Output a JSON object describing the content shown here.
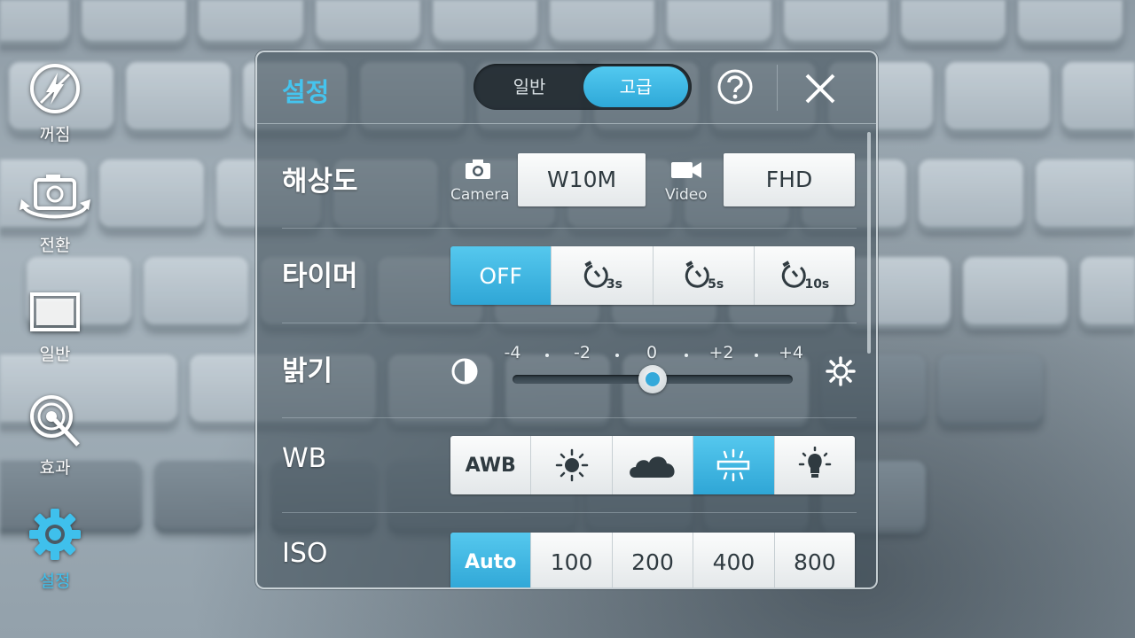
{
  "rail": {
    "flash": {
      "label": "꺼짐",
      "icon": "flash-off-icon"
    },
    "switch": {
      "label": "전환",
      "icon": "switch-camera-icon"
    },
    "mode": {
      "label": "일반",
      "icon": "normal-mode-icon"
    },
    "effects": {
      "label": "효과",
      "icon": "effects-icon"
    },
    "settings": {
      "label": "설정",
      "icon": "gear-icon"
    }
  },
  "panel": {
    "title": "설정",
    "tabs": [
      {
        "label": "일반",
        "selected": false
      },
      {
        "label": "고급",
        "selected": true
      }
    ],
    "help_icon": "help-icon",
    "close_icon": "close-icon"
  },
  "resolution": {
    "label": "해상도",
    "camera_caption": "Camera",
    "camera_value": "W10M",
    "video_caption": "Video",
    "video_value": "FHD"
  },
  "timer": {
    "label": "타이머",
    "options": [
      {
        "label": "OFF",
        "selected": true
      },
      {
        "label": "3s",
        "icon": "timer-icon",
        "selected": false
      },
      {
        "label": "5s",
        "icon": "timer-icon",
        "selected": false
      },
      {
        "label": "10s",
        "icon": "timer-icon",
        "selected": false
      }
    ]
  },
  "brightness": {
    "label": "밝기",
    "ticks": [
      "-4",
      "-2",
      "0",
      "+2",
      "+4"
    ],
    "value": 0,
    "min": -4,
    "max": 4
  },
  "wb": {
    "label": "WB",
    "options": [
      {
        "label": "AWB",
        "selected": false
      },
      {
        "icon": "daylight-icon",
        "selected": false
      },
      {
        "icon": "cloudy-icon",
        "selected": false
      },
      {
        "icon": "fluorescent-icon",
        "selected": true
      },
      {
        "icon": "incandescent-icon",
        "selected": false
      }
    ]
  },
  "iso": {
    "label": "ISO",
    "options": [
      {
        "label": "Auto",
        "selected": true
      },
      {
        "label": "100",
        "selected": false
      },
      {
        "label": "200",
        "selected": false
      },
      {
        "label": "400",
        "selected": false
      },
      {
        "label": "800",
        "selected": false
      }
    ]
  },
  "colors": {
    "accent": "#3fc0ec",
    "selected": "#2fa6d6"
  }
}
